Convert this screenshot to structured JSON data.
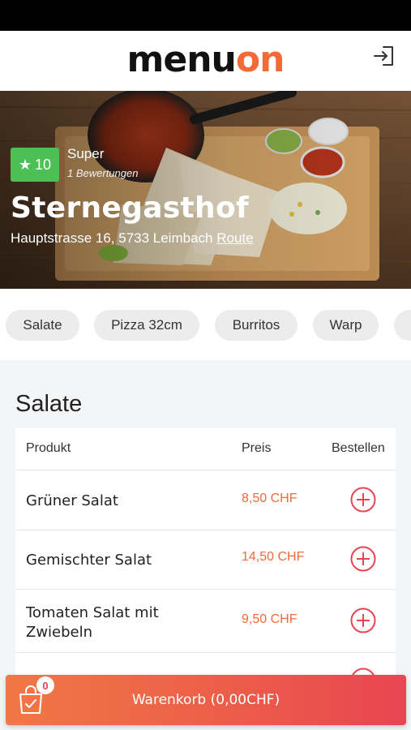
{
  "header": {
    "logo_part1": "menu",
    "logo_part2": "on"
  },
  "restaurant": {
    "rating_value": "10",
    "rating_word": "Super",
    "rating_count": "1 Bewertungen",
    "name": "Sternegasthof",
    "address": "Hauptstrasse 16, 5733 Leimbach",
    "route_label": "Route"
  },
  "categories": [
    "Salate",
    "Pizza 32cm",
    "Burritos",
    "Warp"
  ],
  "section": {
    "title": "Salate",
    "columns": {
      "product": "Produkt",
      "price": "Preis",
      "order": "Bestellen"
    },
    "items": [
      {
        "name": "Grüner Salat",
        "price": "8,50 CHF"
      },
      {
        "name": "Gemischter Salat",
        "price": "14,50 CHF"
      },
      {
        "name": "Tomaten Salat mit Zwiebeln",
        "price": "9,50 CHF"
      }
    ]
  },
  "cart": {
    "label": "Warenkorb (0,00CHF)",
    "count": "0"
  },
  "colors": {
    "accent": "#f06a3a",
    "rating_green": "#4cbf55",
    "cart_gradient_end": "#e84552"
  },
  "icons": {
    "login": "login-icon",
    "star": "star-icon",
    "add": "plus-circle-icon",
    "cart": "shopping-bag-icon"
  }
}
